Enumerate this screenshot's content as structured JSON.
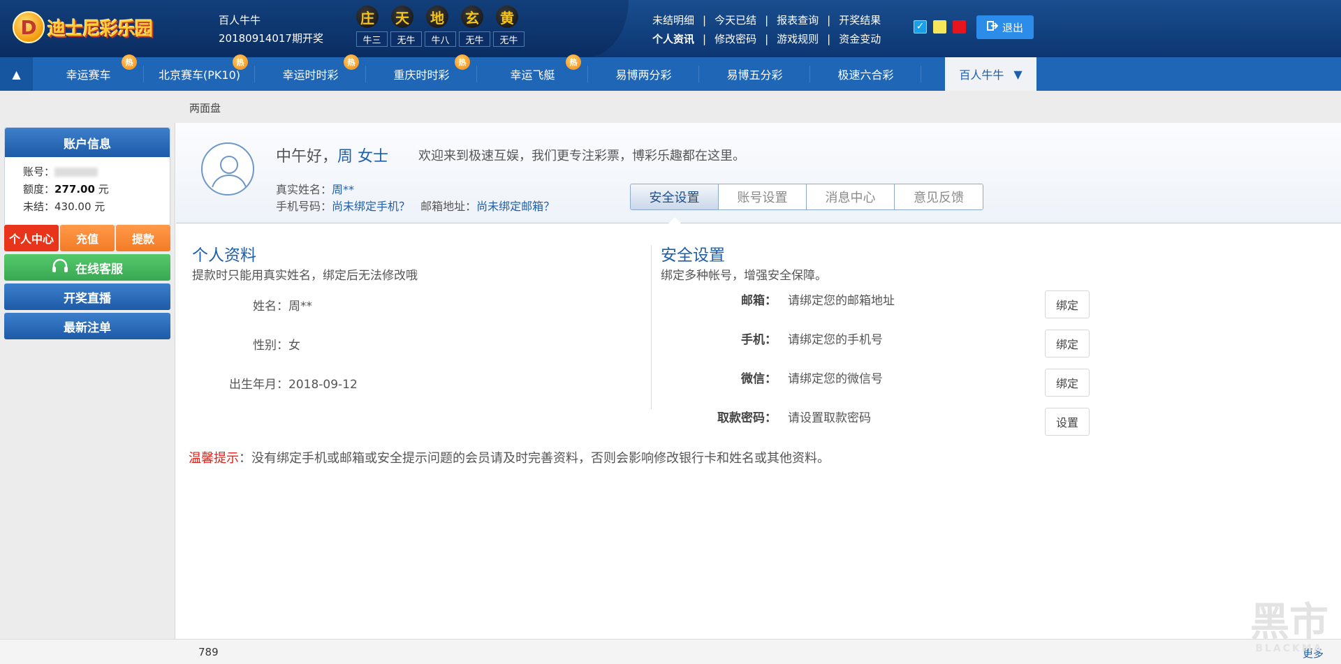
{
  "header": {
    "logo_text": "迪士尼彩乐园",
    "logo_mark": "D",
    "game_name": "百人牛牛",
    "period": "20180914017期开奖",
    "result_chars": [
      "庄",
      "天",
      "地",
      "玄",
      "黄"
    ],
    "result_values": [
      "牛三",
      "无牛",
      "牛八",
      "无牛",
      "无牛"
    ],
    "links_row1": [
      "未结明细",
      "今天已结",
      "报表查询",
      "开奖结果"
    ],
    "links_row2": [
      "个人资讯",
      "修改密码",
      "游戏规则",
      "资金变动"
    ],
    "separator": "|",
    "theme_colors": [
      "#1aa0e8",
      "#f6e65b",
      "#e8141e"
    ],
    "logout_label": "退出",
    "logout_icon": "exit-icon"
  },
  "nav": {
    "items": [
      {
        "label": "幸运赛车",
        "hot": "热"
      },
      {
        "label": "北京赛车(PK10)",
        "hot": "热"
      },
      {
        "label": "幸运时时彩",
        "hot": "热"
      },
      {
        "label": "重庆时时彩",
        "hot": "热"
      },
      {
        "label": "幸运飞艇",
        "hot": "热"
      },
      {
        "label": "易博两分彩"
      },
      {
        "label": "易博五分彩"
      },
      {
        "label": "极速六合彩"
      }
    ],
    "active": "百人牛牛",
    "active_arrow": "▼",
    "up_arrow": "▲"
  },
  "subbar": {
    "label": "两面盘"
  },
  "sidebar": {
    "account_title": "账户信息",
    "account_label": "账号：",
    "quota_label": "额度：",
    "quota_value": "277.00",
    "quota_unit": "元",
    "unsettled_label": "未结：",
    "unsettled_value": "430.00 元",
    "tabs": [
      "个人中心",
      "充值",
      "提款"
    ],
    "online_service": "在线客服",
    "live_draw": "开奖直播",
    "latest_bets": "最新注单"
  },
  "profile": {
    "greeting": "中午好",
    "comma": "，",
    "name": "周 女士",
    "welcome": "欢迎来到极速互娱，我们更专注彩票，博彩乐趣都在这里。",
    "realname_label": "真实姓名：",
    "realname_value": "周**",
    "phone_label": "手机号码：",
    "phone_value": "尚未绑定手机？",
    "email_label": "邮箱地址：",
    "email_value": "尚未绑定邮箱？",
    "tabs": [
      "安全设置",
      "账号设置",
      "消息中心",
      "意见反馈"
    ]
  },
  "personal": {
    "title": "个人资料",
    "subtitle": "提款时只能用真实姓名，绑定后无法修改哦",
    "name_field": "姓名：周**",
    "gender_field": "性别：女",
    "birth_field": "出生年月：2018-09-12"
  },
  "security": {
    "title": "安全设置",
    "subtitle": "绑定多种帐号，增强安全保障。",
    "rows": [
      {
        "label": "邮箱：",
        "text": "请绑定您的邮箱地址",
        "button": "绑定"
      },
      {
        "label": "手机：",
        "text": "请绑定您的手机号",
        "button": "绑定"
      },
      {
        "label": "微信：",
        "text": "请绑定您的微信号",
        "button": "绑定"
      },
      {
        "label": "取款密码：",
        "text": "请设置取款密码",
        "button": "设置"
      }
    ]
  },
  "tip": {
    "label": "温馨提示",
    "text": "：没有绑定手机或邮箱或安全提示问题的会员请及时完善资料，否则会影响修改银行卡和姓名或其他资料。"
  },
  "footer": {
    "number": "789",
    "more": "更多"
  },
  "watermark": {
    "main": "黑市",
    "sub": "BLACKMA"
  }
}
